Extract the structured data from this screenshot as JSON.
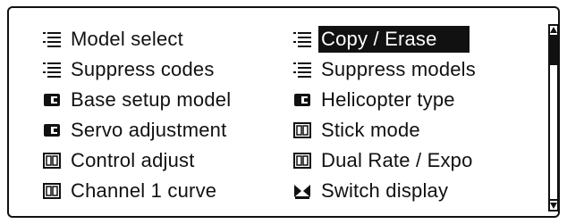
{
  "menu": {
    "items": [
      {
        "label": "Model select",
        "icon": "list-icon"
      },
      {
        "label": "Copy / Erase",
        "icon": "list-icon",
        "selected": true
      },
      {
        "label": "Suppress codes",
        "icon": "list-icon"
      },
      {
        "label": "Suppress models",
        "icon": "list-icon"
      },
      {
        "label": "Base setup model",
        "icon": "model-setup-icon"
      },
      {
        "label": "Helicopter type",
        "icon": "model-setup-icon"
      },
      {
        "label": "Servo adjustment",
        "icon": "model-setup-icon"
      },
      {
        "label": "Stick mode",
        "icon": "transmitter-icon"
      },
      {
        "label": "Control adjust",
        "icon": "transmitter-icon"
      },
      {
        "label": "Dual Rate / Expo",
        "icon": "transmitter-icon"
      },
      {
        "label": "Channel 1 curve",
        "icon": "transmitter-icon"
      },
      {
        "label": "Switch display",
        "icon": "switch-icon"
      }
    ]
  },
  "colors": {
    "foreground": "#111111",
    "background": "#ffffff",
    "selection": "#111111"
  }
}
